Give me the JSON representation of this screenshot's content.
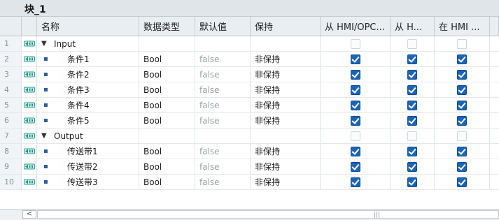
{
  "block_title": "块_1",
  "headers": {
    "name": "名称",
    "datatype": "数据类型",
    "default": "默认值",
    "retain": "保持",
    "col1": "从 HMI/OPC...",
    "col2": "从 H...",
    "col3": "在 HMI ..."
  },
  "rows": [
    {
      "num": "1",
      "kind": "section",
      "name": "Input",
      "type": "",
      "default": "",
      "retain": "",
      "c1": false,
      "c2": false,
      "c3": false
    },
    {
      "num": "2",
      "kind": "item",
      "name": "条件1",
      "type": "Bool",
      "default": "false",
      "retain": "非保持",
      "c1": true,
      "c2": true,
      "c3": true
    },
    {
      "num": "3",
      "kind": "item",
      "name": "条件2",
      "type": "Bool",
      "default": "false",
      "retain": "非保持",
      "c1": true,
      "c2": true,
      "c3": true
    },
    {
      "num": "4",
      "kind": "item",
      "name": "条件3",
      "type": "Bool",
      "default": "false",
      "retain": "非保持",
      "c1": true,
      "c2": true,
      "c3": true
    },
    {
      "num": "5",
      "kind": "item",
      "name": "条件4",
      "type": "Bool",
      "default": "false",
      "retain": "非保持",
      "c1": true,
      "c2": true,
      "c3": true
    },
    {
      "num": "6",
      "kind": "item",
      "name": "条件5",
      "type": "Bool",
      "default": "false",
      "retain": "非保持",
      "c1": true,
      "c2": true,
      "c3": true
    },
    {
      "num": "7",
      "kind": "section",
      "name": "Output",
      "type": "",
      "default": "",
      "retain": "",
      "c1": false,
      "c2": false,
      "c3": false
    },
    {
      "num": "8",
      "kind": "item",
      "name": "传送带1",
      "type": "Bool",
      "default": "false",
      "retain": "非保持",
      "c1": true,
      "c2": true,
      "c3": true
    },
    {
      "num": "9",
      "kind": "item",
      "name": "传送带2",
      "type": "Bool",
      "default": "false",
      "retain": "非保持",
      "c1": true,
      "c2": true,
      "c3": true
    },
    {
      "num": "10",
      "kind": "item",
      "name": "传送带3",
      "type": "Bool",
      "default": "false",
      "retain": "非保持",
      "c1": true,
      "c2": true,
      "c3": true
    }
  ],
  "scrollbar": {
    "left_arrow": "<",
    "grip": "|||"
  },
  "colors": {
    "checkbox_checked": "#1b65b8",
    "interface_icon": "#1f9a8a",
    "header_bg": "#e9eef1"
  }
}
